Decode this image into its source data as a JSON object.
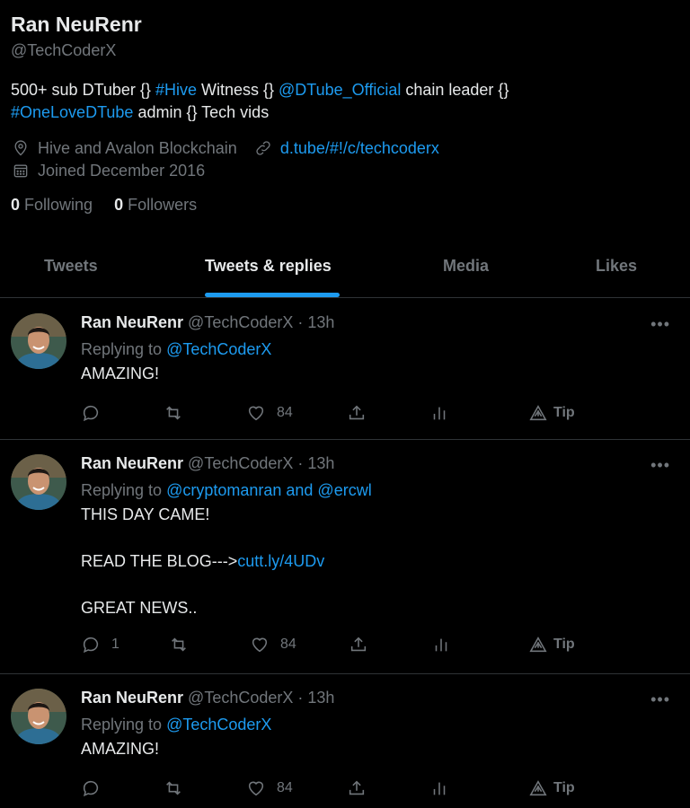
{
  "profile": {
    "name": "Ran NeuRenr",
    "handle": "@TechCoderX",
    "bio": {
      "t1": "500+ sub DTuber {} ",
      "hive_tag": "#Hive",
      "t2": " Witness {} ",
      "dtube_mention": "@DTube_Official",
      "t3": " chain leader {}",
      "onelove_tag": "#OneLoveDTube",
      "t4": " admin {} Tech vids"
    },
    "location": "Hive and Avalon Blockchain",
    "website": "d.tube/#!/c/techcoderx",
    "joined": "Joined December 2016",
    "following_count": "0",
    "following_label": "Following",
    "followers_count": "0",
    "followers_label": "Followers"
  },
  "tabs": [
    "Tweets",
    "Tweets & replies",
    "Media",
    "Likes"
  ],
  "active_tab": "Tweets & replies",
  "tweets": [
    {
      "name": "Ran NeuRenr",
      "handle": "@TechCoderX",
      "time": "· 13h",
      "replying_label": "Replying to",
      "replying_to": "@TechCoderX",
      "lines": [
        "AMAZING!"
      ],
      "replies": "",
      "likes": "84",
      "tip": "Tip"
    },
    {
      "name": "Ran NeuRenr",
      "handle": "@TechCoderX",
      "time": "· 13h",
      "replying_label": "Replying to",
      "replying_to": "@cryptomanran and @ercwl",
      "line1": "THIS DAY CAME!",
      "line2_text": "READ THE BLOG--->",
      "line2_link": "cutt.ly/4UDv",
      "line3": "GREAT NEWS..",
      "replies": "1",
      "likes": "84",
      "tip": "Tip"
    },
    {
      "name": "Ran NeuRenr",
      "handle": "@TechCoderX",
      "time": "· 13h",
      "replying_label": "Replying to",
      "replying_to": "@TechCoderX",
      "lines": [
        "AMAZING!"
      ],
      "replies": "",
      "likes": "84",
      "tip": "Tip"
    }
  ],
  "icons": {
    "location": "location-pin-icon",
    "link": "link-icon",
    "calendar": "calendar-icon",
    "reply": "reply-icon",
    "retweet": "retweet-icon",
    "like": "heart-icon",
    "share": "share-icon",
    "analytics": "analytics-icon",
    "tip": "tip-icon",
    "more": "more-icon"
  },
  "colors": {
    "background": "#000000",
    "accent": "#1d9bf0",
    "text": "#e7e9ea",
    "muted": "#71767b",
    "divider": "#2f3336"
  }
}
